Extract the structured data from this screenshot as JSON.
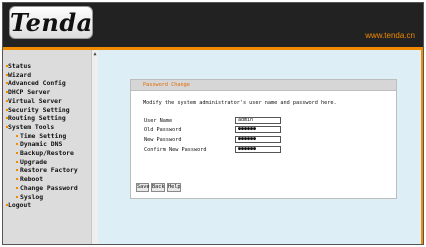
{
  "header": {
    "logo_text": "Tenda",
    "url": "www.tenda.cn"
  },
  "sidebar": {
    "items": [
      {
        "label": "Status",
        "sub": false
      },
      {
        "label": "Wizard",
        "sub": false
      },
      {
        "label": "Advanced Config",
        "sub": false
      },
      {
        "label": "DHCP Server",
        "sub": false
      },
      {
        "label": "Virtual Server",
        "sub": false
      },
      {
        "label": "Security Setting",
        "sub": false
      },
      {
        "label": "Routing Setting",
        "sub": false
      },
      {
        "label": "System Tools",
        "sub": false
      },
      {
        "label": "Time Setting",
        "sub": true
      },
      {
        "label": "Dynamic DNS",
        "sub": true
      },
      {
        "label": "Backup/Restore",
        "sub": true
      },
      {
        "label": "Upgrade",
        "sub": true
      },
      {
        "label": "Restore Factory",
        "sub": true
      },
      {
        "label": "Reboot",
        "sub": true
      },
      {
        "label": "Change Password",
        "sub": true
      },
      {
        "label": "Syslog",
        "sub": true
      },
      {
        "label": "Logout",
        "sub": false
      }
    ]
  },
  "panel": {
    "title": "Password Change",
    "description": "Modify the system administrator's user name and password here.",
    "fields": [
      {
        "label": "User Name",
        "value": "admin"
      },
      {
        "label": "Old Password",
        "value": "●●●●●●"
      },
      {
        "label": "New Password",
        "value": "●●●●●●"
      },
      {
        "label": "Confirm New Password",
        "value": "●●●●●●"
      }
    ]
  },
  "buttons": {
    "save": "Save",
    "back": "Back",
    "help": "Help"
  },
  "colors": {
    "accent": "#f08a00",
    "header_bg": "#222222",
    "main_bg": "#ddeef7",
    "sidebar_bg": "#dcdcdc",
    "title_text": "#e26a00"
  }
}
